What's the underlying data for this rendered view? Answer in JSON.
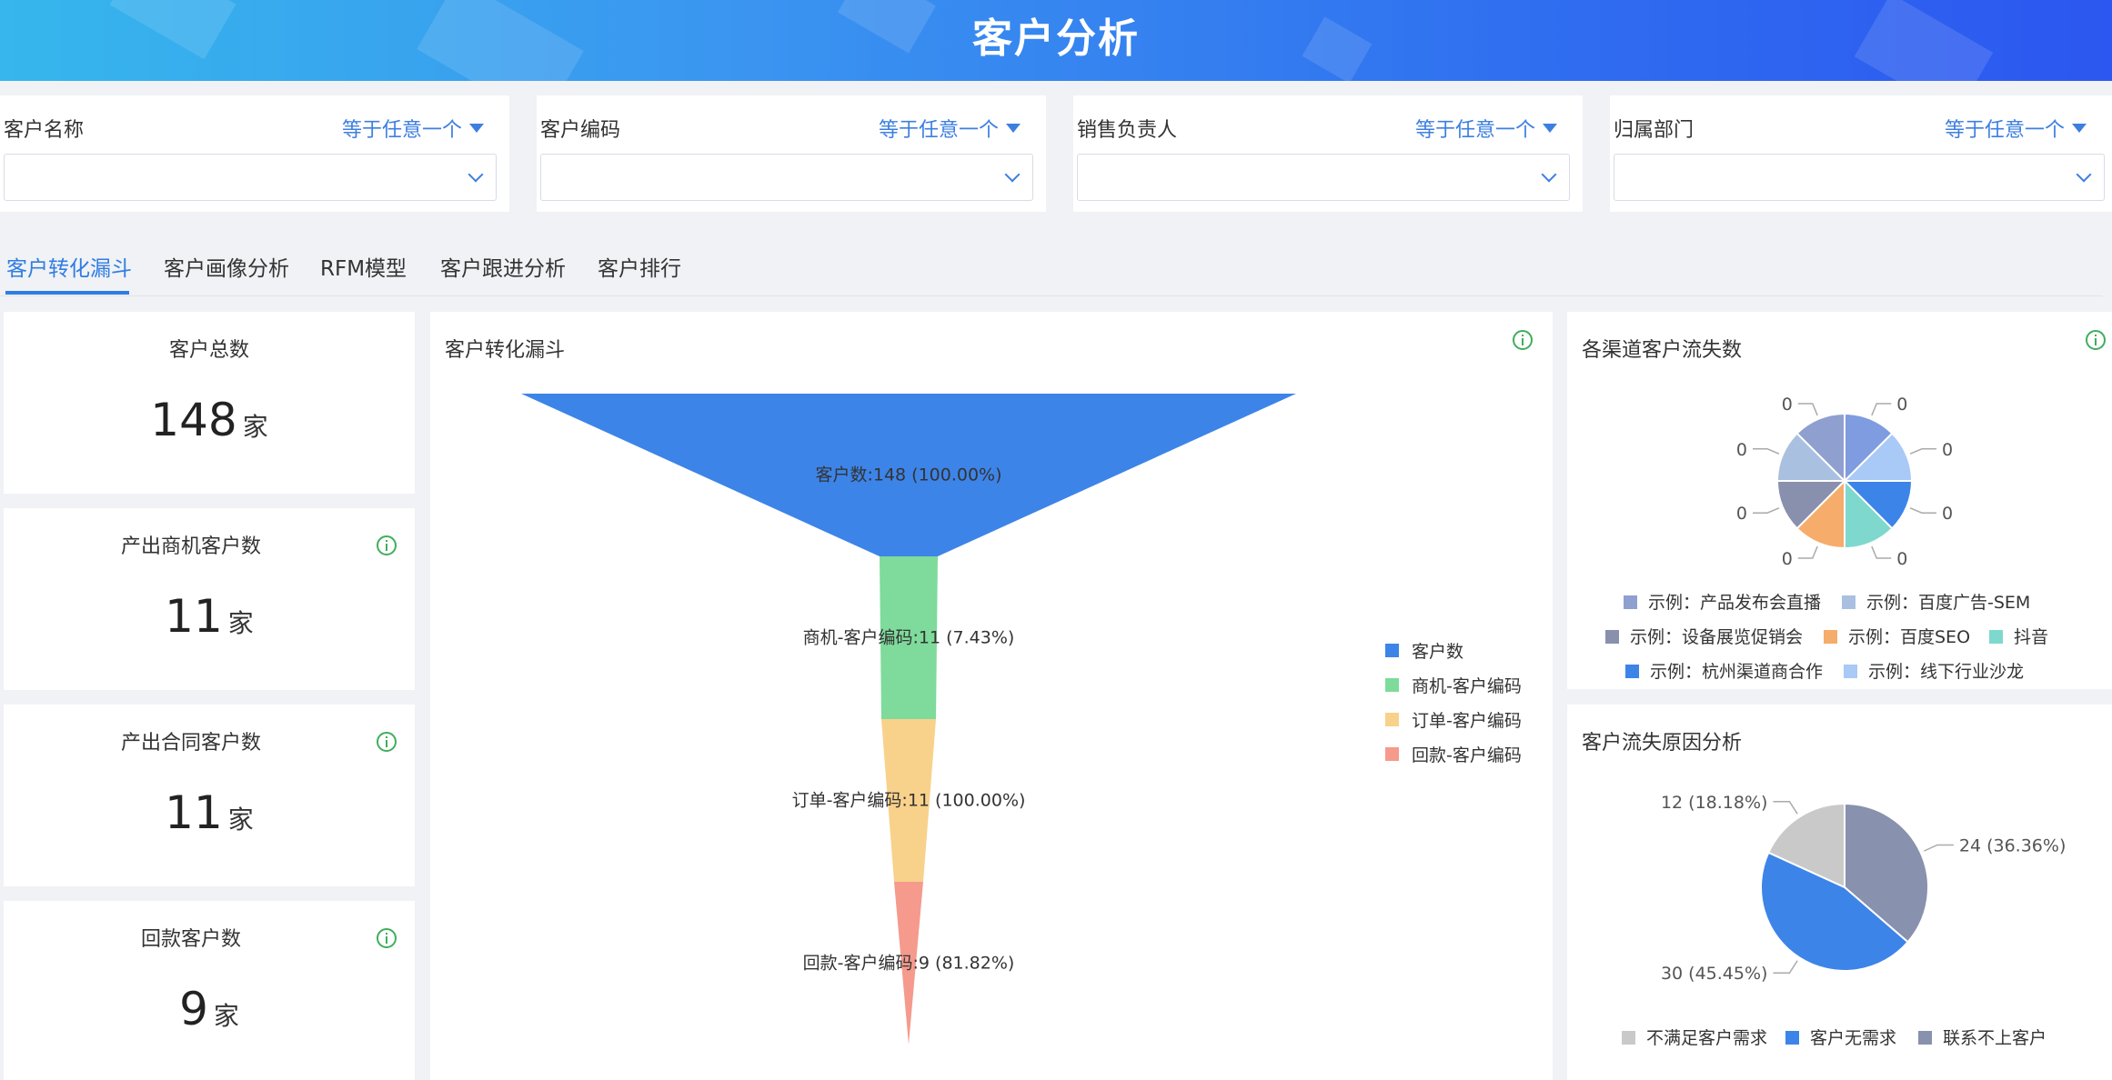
{
  "header": {
    "title": "客户分析"
  },
  "filters": [
    {
      "label": "客户名称",
      "operator": "等于任意一个",
      "value": ""
    },
    {
      "label": "客户编码",
      "operator": "等于任意一个",
      "value": ""
    },
    {
      "label": "销售负责人",
      "operator": "等于任意一个",
      "value": ""
    },
    {
      "label": "归属部门",
      "operator": "等于任意一个",
      "value": ""
    }
  ],
  "tabs": [
    {
      "label": "客户转化漏斗",
      "active": true
    },
    {
      "label": "客户画像分析",
      "active": false
    },
    {
      "label": "RFM模型",
      "active": false
    },
    {
      "label": "客户跟进分析",
      "active": false
    },
    {
      "label": "客户排行",
      "active": false
    }
  ],
  "kpis": [
    {
      "title": "客户总数",
      "value": "148",
      "unit": "家",
      "info": false
    },
    {
      "title": "产出商机客户数",
      "value": "11",
      "unit": "家",
      "info": true
    },
    {
      "title": "产出合同客户数",
      "value": "11",
      "unit": "家",
      "info": true
    },
    {
      "title": "回款客户数",
      "value": "9",
      "unit": "家",
      "info": true
    }
  ],
  "colors": {
    "accent": "#2f7de1",
    "info_icon": "#3fae5c"
  },
  "funnel": {
    "title": "客户转化漏斗",
    "chart_data": {
      "type": "funnel",
      "stages": [
        {
          "name": "客户数",
          "value": 148,
          "percent": "100.00%",
          "color": "#3d84e8"
        },
        {
          "name": "商机-客户编码",
          "value": 11,
          "percent": "7.43%",
          "color": "#7edb9b"
        },
        {
          "name": "订单-客户编码",
          "value": 11,
          "percent": "100.00%",
          "color": "#f8d18b"
        },
        {
          "name": "回款-客户编码",
          "value": 9,
          "percent": "81.82%",
          "color": "#f59a8d"
        }
      ],
      "legend": [
        "客户数",
        "商机-客户编码",
        "订单-客户编码",
        "回款-客户编码"
      ],
      "legend_position": "right"
    }
  },
  "channel_churn": {
    "title": "各渠道客户流失数",
    "chart_data": {
      "type": "pie",
      "slices": [
        {
          "name": "示例：产品发布会直播",
          "value": 0,
          "color": "#8f9fd0"
        },
        {
          "name": "示例：百度广告-SEM",
          "value": 0,
          "color": "#aac0e0"
        },
        {
          "name": "示例：设备展览促销会",
          "value": 0,
          "color": "#8890ad"
        },
        {
          "name": "示例：百度SEO",
          "value": 0,
          "color": "#f6ac6a"
        },
        {
          "name": "抖音",
          "value": 0,
          "color": "#7fd8cd"
        },
        {
          "name": "示例：杭州渠道商合作",
          "value": 0,
          "color": "#3d84e8"
        },
        {
          "name": "示例：线下行业沙龙",
          "value": 0,
          "color": "#a9c9f6"
        },
        {
          "name": "",
          "value": 0,
          "color": "#7f9ce0"
        }
      ],
      "slice_labels": [
        "0",
        "0",
        "0",
        "0",
        "0",
        "0",
        "0",
        "0"
      ],
      "legend_position": "bottom"
    }
  },
  "churn_reason": {
    "title": "客户流失原因分析",
    "chart_data": {
      "type": "pie",
      "slices": [
        {
          "name": "联系不上客户",
          "value": 24,
          "percent": "36.36%",
          "label": "24 (36.36%)",
          "color": "#8891ad"
        },
        {
          "name": "客户无需求",
          "value": 30,
          "percent": "45.45%",
          "label": "30 (45.45%)",
          "color": "#3d84e8"
        },
        {
          "name": "不满足客户需求",
          "value": 12,
          "percent": "18.18%",
          "label": "12 (18.18%)",
          "color": "#c9c9c9"
        }
      ],
      "legend": [
        "不满足客户需求",
        "客户无需求",
        "联系不上客户"
      ],
      "legend_position": "bottom"
    }
  }
}
